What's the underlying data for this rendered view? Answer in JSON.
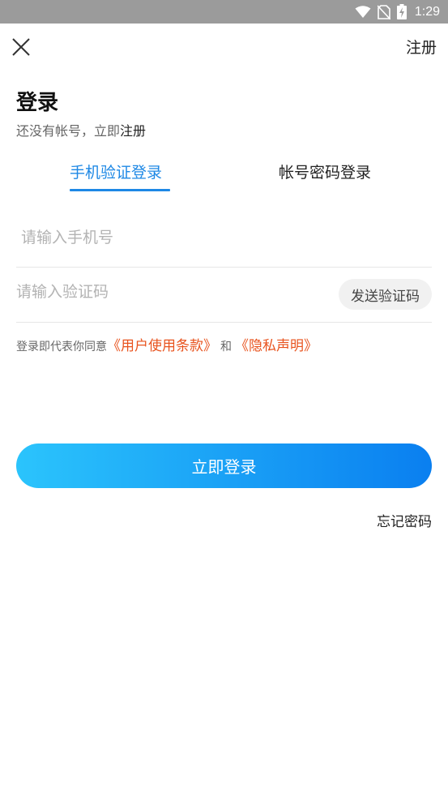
{
  "status_bar": {
    "time": "1:29",
    "icons": [
      "wifi-icon",
      "no-sim-icon",
      "battery-charging-icon"
    ]
  },
  "header": {
    "close_icon": "close-icon",
    "register_label": "注册"
  },
  "title": "登录",
  "subtitle": {
    "prefix": "还没有帐号，立即",
    "register_link": "注册"
  },
  "tabs": [
    {
      "label": "手机验证登录",
      "active": true
    },
    {
      "label": "帐号密码登录",
      "active": false
    }
  ],
  "form": {
    "phone_placeholder": "请输入手机号",
    "phone_value": "",
    "code_placeholder": "请输入验证码",
    "code_value": "",
    "send_code_label": "发送验证码"
  },
  "agreement": {
    "prefix": "登录即代表你同意",
    "terms_link": "《用户使用条款》",
    "and_text": "和",
    "privacy_link": "《隐私声明》"
  },
  "login_button_label": "立即登录",
  "forgot_password_label": "忘记密码",
  "colors": {
    "accent": "#1e88e5",
    "link_orange": "#e8531e",
    "button_gradient_start": "#2bc4fc",
    "button_gradient_end": "#0a7ff0",
    "status_bar_bg": "#9b9b9b"
  }
}
